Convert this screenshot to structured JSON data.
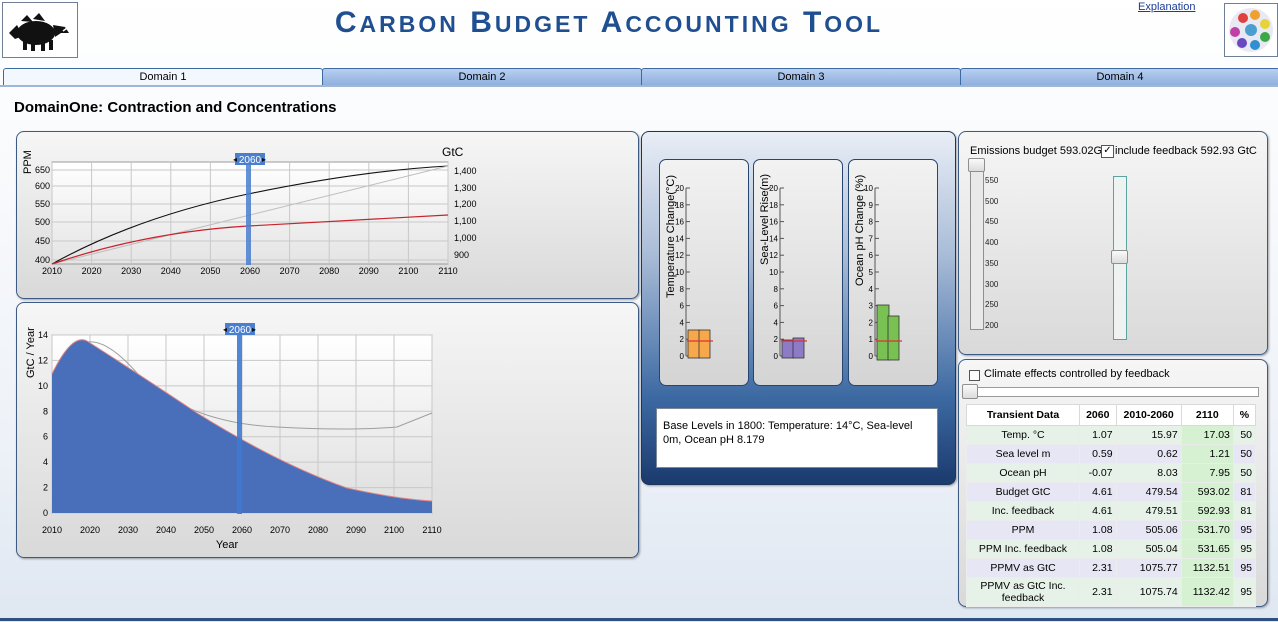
{
  "header": {
    "title_parts": [
      {
        "cap": "C",
        "rest": "ARBON"
      },
      {
        "cap": "B",
        "rest": "UDGET"
      },
      {
        "cap": "A",
        "rest": "CCOUNTING"
      },
      {
        "cap": "T",
        "rest": "OOL"
      }
    ],
    "explanation_link": "Explanation"
  },
  "tabs": [
    {
      "label": "Domain 1",
      "active": true
    },
    {
      "label": "Domain 2",
      "active": false
    },
    {
      "label": "Domain 3",
      "active": false
    },
    {
      "label": "Domain 4",
      "active": false
    }
  ],
  "section_title": "DomainOne: Contraction and Concentrations",
  "ppm_chart": {
    "ylabel_left": "PPM",
    "ylabel_right": "GtC",
    "marker_year": "2060",
    "x_ticks": [
      "2010",
      "2020",
      "2030",
      "2040",
      "2050",
      "2060",
      "2070",
      "2080",
      "2090",
      "2100",
      "2110"
    ],
    "y_left_ticks": [
      "650",
      "600",
      "550",
      "500",
      "450",
      "400"
    ],
    "y_right_ticks": [
      "1,400",
      "1,300",
      "1,200",
      "1,100",
      "1,000",
      "900"
    ]
  },
  "emissions_chart": {
    "ylabel": "GtC / Year",
    "xlabel": "Year",
    "marker_year": "2060",
    "x_ticks": [
      "2010",
      "2020",
      "2030",
      "2040",
      "2050",
      "2060",
      "2070",
      "2080",
      "2090",
      "2100",
      "2110"
    ],
    "y_ticks": [
      "14",
      "12",
      "10",
      "8",
      "6",
      "4",
      "2",
      "0"
    ]
  },
  "thermometers": [
    {
      "label": "Temperature Change(°C)",
      "ticks": [
        "20",
        "18",
        "16",
        "14",
        "12",
        "10",
        "8",
        "6",
        "4",
        "2",
        "0"
      ],
      "bar_color": "#f7a84a"
    },
    {
      "label": "Sea-Level Rise(m)",
      "ticks": [
        "20",
        "18",
        "16",
        "14",
        "12",
        "10",
        "8",
        "6",
        "4",
        "2",
        "0"
      ],
      "bar_color": "#8e7bc8"
    },
    {
      "label": "Ocean pH Change (%)",
      "ticks": [
        "10",
        "9",
        "8",
        "7",
        "6",
        "5",
        "4",
        "3",
        "2",
        "1",
        "0"
      ],
      "bar_color": "#78c152"
    }
  ],
  "base_levels": "Base Levels in 1800: Temperature: 14°C, Sea-level 0m, Ocean pH 8.179",
  "budget_panel": {
    "emissions_budget": "Emissions budget 593.02GtC",
    "include_feedback": "include feedback 592.93 GtC",
    "include_feedback_checked": true,
    "slider_ticks": [
      "550",
      "500",
      "450",
      "400",
      "350",
      "300",
      "250",
      "200"
    ]
  },
  "feedback_panel": {
    "climate_effects_label": "Climate effects controlled by feedback",
    "climate_effects_checked": false
  },
  "transient_table": {
    "headers": [
      "Transient Data",
      "2060",
      "2010-2060",
      "2110",
      "%"
    ],
    "rows": [
      [
        "Temp. °C",
        "1.07",
        "15.97",
        "17.03",
        "50"
      ],
      [
        "Sea level m",
        "0.59",
        "0.62",
        "1.21",
        "50"
      ],
      [
        "Ocean pH",
        "-0.07",
        "8.03",
        "7.95",
        "50"
      ],
      [
        "Budget GtC",
        "4.61",
        "479.54",
        "593.02",
        "81"
      ],
      [
        "Inc. feedback",
        "4.61",
        "479.51",
        "592.93",
        "81"
      ],
      [
        "PPM",
        "1.08",
        "505.06",
        "531.70",
        "95"
      ],
      [
        "PPM Inc. feedback",
        "1.08",
        "505.04",
        "531.65",
        "95"
      ],
      [
        "PPMV as GtC",
        "2.31",
        "1075.77",
        "1132.51",
        "95"
      ],
      [
        "PPMV as GtC Inc. feedback",
        "2.31",
        "1075.74",
        "1132.42",
        "95"
      ]
    ]
  },
  "colors": {
    "title": "#1f4f91",
    "accent": "#4a74c0",
    "area_fill": "#4a6fba",
    "ppm_line": "#c8232c"
  }
}
